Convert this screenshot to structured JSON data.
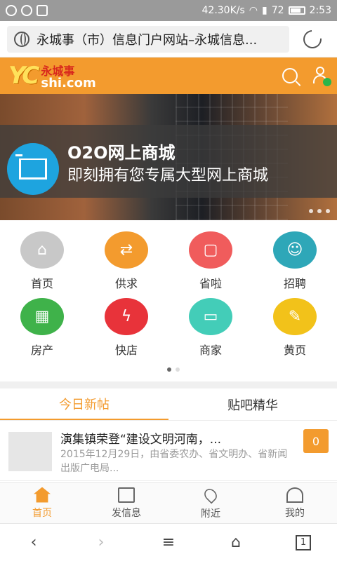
{
  "status_bar": {
    "speed": "42.30K/s",
    "battery": "72",
    "time": "2:53"
  },
  "browser": {
    "url_text": "永城事（市）信息门户网站–永城信息..."
  },
  "site": {
    "logo_letters": "YC",
    "logo_cn": "永城事",
    "logo_en": "shi.com"
  },
  "banner": {
    "line1": "O2O网上商城",
    "line2": "即刻拥有您专属大型网上商城"
  },
  "grid": [
    {
      "label": "首页",
      "icon": "home-icon",
      "color": "#c8c8c8"
    },
    {
      "label": "供求",
      "icon": "exchange-icon",
      "color": "#f39b2e"
    },
    {
      "label": "省啦",
      "icon": "bag-icon",
      "color": "#f05c5c"
    },
    {
      "label": "招聘",
      "icon": "person-tie-icon",
      "color": "#2ea7b8"
    },
    {
      "label": "房产",
      "icon": "building-icon",
      "color": "#3fb24a"
    },
    {
      "label": "快店",
      "icon": "lightning-icon",
      "color": "#e8333a"
    },
    {
      "label": "商家",
      "icon": "store-icon",
      "color": "#43cdb8"
    },
    {
      "label": "黄页",
      "icon": "note-icon",
      "color": "#f2c21a"
    }
  ],
  "tabs": [
    {
      "label": "今日新帖",
      "active": true
    },
    {
      "label": "贴吧精华",
      "active": false
    }
  ],
  "news": {
    "title": "演集镇荣登“建设文明河南，...",
    "desc": "2015年12月29日，由省委农办、省文明办、省新闻出版广电局...",
    "badge": "0"
  },
  "appnav": [
    {
      "label": "首页",
      "icon": "home-icon",
      "active": true
    },
    {
      "label": "发信息",
      "icon": "edit-icon",
      "active": false
    },
    {
      "label": "附近",
      "icon": "location-icon",
      "active": false
    },
    {
      "label": "我的",
      "icon": "person-icon",
      "active": false
    }
  ],
  "browser_bar": {
    "tab_count": "1"
  },
  "colors": {
    "brand": "#f39b2e",
    "header": "#f39b2e"
  }
}
